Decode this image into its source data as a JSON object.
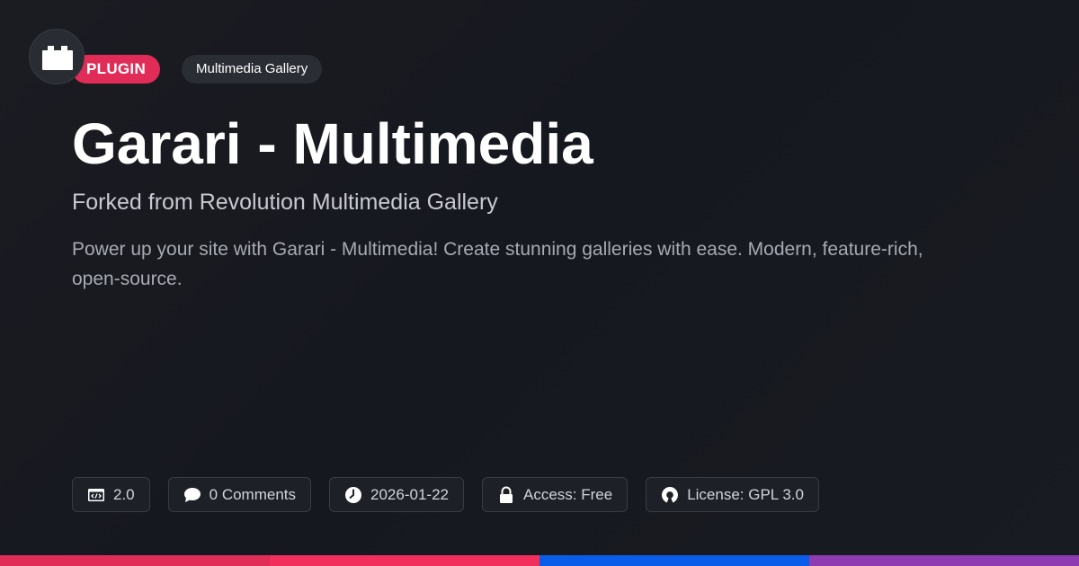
{
  "logo": {
    "icon": "plugin-block-icon"
  },
  "tags": {
    "type_badge": "PLUGIN",
    "category": "Multimedia Gallery"
  },
  "title": "Garari - Multimedia",
  "subtitle": "Forked from Revolution Multimedia Gallery",
  "description": "Power up your site with Garari - Multimedia! Create stunning galleries with ease. Modern, feature-rich, open-source.",
  "meta": [
    {
      "icon": "code-version-icon",
      "label": "2.0"
    },
    {
      "icon": "comment-icon",
      "label": "0 Comments"
    },
    {
      "icon": "clock-icon",
      "label": "2026-01-22"
    },
    {
      "icon": "lock-icon",
      "label": "Access: Free"
    },
    {
      "icon": "open-source-icon",
      "label": "License: GPL 3.0"
    }
  ],
  "colors": {
    "plugin_badge": "#e02c57",
    "bottom_bar": [
      "#e02c57",
      "#f22e5c",
      "#0a5de8",
      "#8e3ab0"
    ]
  }
}
